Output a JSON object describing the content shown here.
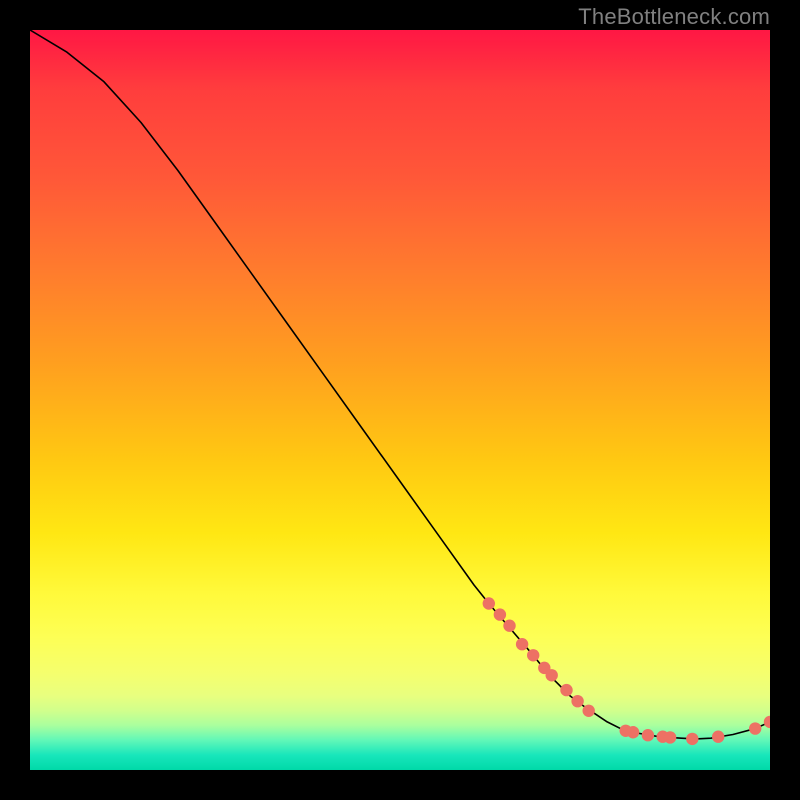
{
  "watermark": "TheBottleneck.com",
  "chart_data": {
    "type": "line",
    "title": "",
    "xlabel": "",
    "ylabel": "",
    "xlim": [
      0,
      100
    ],
    "ylim": [
      0,
      100
    ],
    "series": [
      {
        "name": "curve",
        "x": [
          0,
          5,
          10,
          15,
          20,
          25,
          30,
          35,
          40,
          45,
          50,
          55,
          60,
          62,
          65,
          68,
          70,
          73,
          75,
          78,
          80,
          82,
          85,
          88,
          90,
          92,
          95,
          98,
          100
        ],
        "y": [
          100,
          97,
          93,
          87.5,
          81,
          74,
          67,
          60,
          53,
          46,
          39,
          32,
          25,
          22.5,
          19,
          15.5,
          13,
          10,
          8.5,
          6.5,
          5.5,
          5,
          4.5,
          4.3,
          4.2,
          4.3,
          4.8,
          5.6,
          6.5
        ]
      }
    ],
    "markers": [
      {
        "x": 62.0,
        "y": 22.5
      },
      {
        "x": 63.5,
        "y": 21.0
      },
      {
        "x": 64.8,
        "y": 19.5
      },
      {
        "x": 66.5,
        "y": 17.0
      },
      {
        "x": 68.0,
        "y": 15.5
      },
      {
        "x": 69.5,
        "y": 13.8
      },
      {
        "x": 70.5,
        "y": 12.8
      },
      {
        "x": 72.5,
        "y": 10.8
      },
      {
        "x": 74.0,
        "y": 9.3
      },
      {
        "x": 75.5,
        "y": 8.0
      },
      {
        "x": 80.5,
        "y": 5.3
      },
      {
        "x": 81.5,
        "y": 5.1
      },
      {
        "x": 83.5,
        "y": 4.7
      },
      {
        "x": 85.5,
        "y": 4.5
      },
      {
        "x": 86.5,
        "y": 4.4
      },
      {
        "x": 89.5,
        "y": 4.2
      },
      {
        "x": 93.0,
        "y": 4.5
      },
      {
        "x": 98.0,
        "y": 5.6
      },
      {
        "x": 100.0,
        "y": 6.5
      }
    ],
    "marker_color": "#ed7164",
    "curve_color": "#000000",
    "gradient_stops": [
      {
        "pos": 0,
        "color": "#ff1744"
      },
      {
        "pos": 45,
        "color": "#ff9f1f"
      },
      {
        "pos": 76,
        "color": "#fff93a"
      },
      {
        "pos": 96,
        "color": "#60f7b8"
      },
      {
        "pos": 100,
        "color": "#00d9a8"
      }
    ]
  }
}
